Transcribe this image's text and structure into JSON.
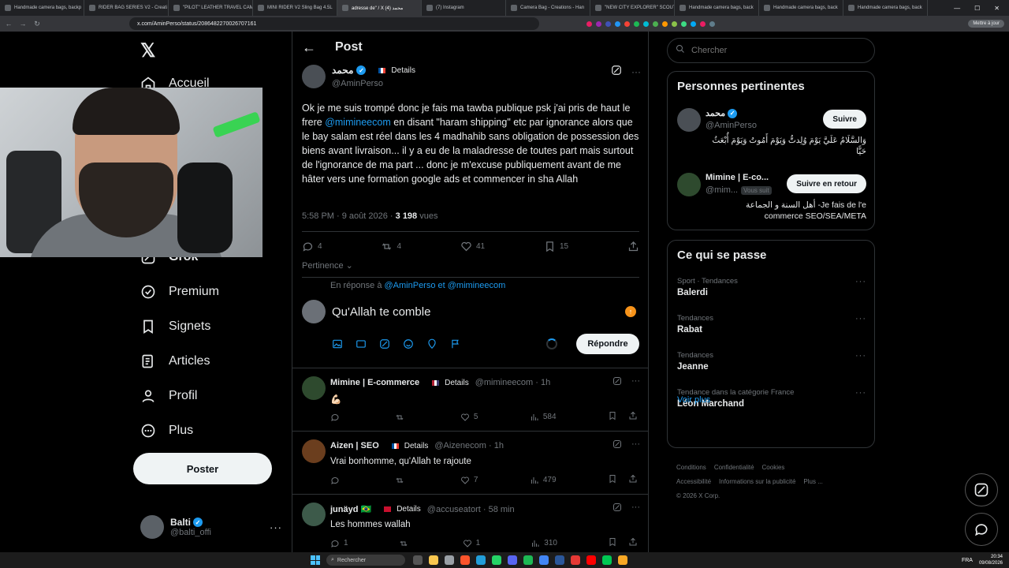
{
  "browser": {
    "tabs": [
      {
        "label": "Handmade camera bags, backp"
      },
      {
        "label": "RIDER BAG SERIES V2 - Creati"
      },
      {
        "label": "\"PILOT\" LEATHER TRAVEL CAM"
      },
      {
        "label": "MINI RIDER V2 Sling Bag 4.5L"
      },
      {
        "label": "adresse de\" / X محمد (4)"
      },
      {
        "label": "(7) Instagram"
      },
      {
        "label": "Camera Bag - Creations - Han"
      },
      {
        "label": "\"NEW CITY EXPLORER\" SCOUT"
      },
      {
        "label": "Handmade camera bags, back"
      },
      {
        "label": "Handmade camera bags, back"
      },
      {
        "label": "Handmade camera bags, back"
      }
    ],
    "url": "x.com/AminPerso/status/2086482270026707161",
    "menu_pill": "Mettre à jour",
    "ext_colors": [
      "#e91e63",
      "#9c27b0",
      "#3f51b5",
      "#2196f3",
      "#f44336",
      "#1db954",
      "#00bcd4",
      "#4caf50",
      "#ff9800",
      "#8bc34a",
      "#3ddc84",
      "#03a9f4",
      "#e91e63",
      "#607d8b"
    ]
  },
  "nav": {
    "home": "Accueil",
    "grok": "Grok",
    "premium": "Premium",
    "bookmarks": "Signets",
    "articles": "Articles",
    "profile": "Profil",
    "more": "Plus",
    "post_button": "Poster",
    "account_name": "Balti",
    "account_handle": "@balti_offi"
  },
  "main": {
    "title": "Post",
    "tweet": {
      "author": "محمد",
      "details": "Details",
      "handle": "@AminPerso",
      "text_a": "Ok je me suis trompé donc je fais ma tawba publique psk j'ai pris de haut le frere ",
      "mention": "@mimineecom",
      "text_b": " en disant \"haram shipping\" etc par ignorance alors que le bay salam est réel dans les 4 madhahib sans obligation de possession des biens avant livraison... il y a eu de la maladresse de toutes part mais surtout de l'ignorance de ma part ... donc je m'excuse publiquement avant de me hâter vers une formation google ads et commencer in sha Allah",
      "time": "5:58 PM · 9 août 2026 · ",
      "views_count": "3 198",
      "views_label": " vues",
      "replies": "4",
      "reposts": "4",
      "likes": "41",
      "bookmarks": "15"
    },
    "sort_label": "Pertinence",
    "reply_to_prefix": "En réponse à ",
    "reply_to_users": "@AminPerso et @mimineecom",
    "composer_value": "Qu'Allah te comble",
    "reply_button": "Répondre",
    "replies": [
      {
        "name": "Mimine | E-commerce",
        "details": "Details",
        "meta": "@mimineecom · 1h",
        "text": "💪🏻",
        "likes": "5",
        "views": "584",
        "replies": "",
        "reposts": ""
      },
      {
        "name": "Aizen | SEO",
        "details": "Details",
        "meta": "@Aizenecom · 1h",
        "text": "Vrai bonhomme, qu'Allah te rajoute",
        "likes": "7",
        "views": "479",
        "replies": "",
        "reposts": ""
      },
      {
        "name": "junäyd 🇧🇷",
        "details": "Details",
        "meta": "@accuseatort · 58 min",
        "text": "Les hommes wallah",
        "likes": "1",
        "views": "310",
        "replies": "1",
        "reposts": ""
      }
    ]
  },
  "right": {
    "search_placeholder": "Chercher",
    "people_title": "Personnes pertinentes",
    "people": [
      {
        "name": "محمد",
        "handle": "@AminPerso",
        "follows_you": "",
        "button": "Suivre",
        "bio": "وَالسَّلَامُ عَلَيَّ يَوْمَ وُلِدتُّ وَيَوْمَ أَمُوتُ وَيَوْمَ أُبْعَثُ حَيًّا"
      },
      {
        "name": "Mimine | E-co...",
        "handle": "@mim...",
        "follows_you": "Vous suit",
        "button": "Suivre en retour",
        "bio": "أهل السنة و الجماعة -Je fais de l'e commerce SEO/SEA/META"
      }
    ],
    "trends_title": "Ce qui se passe",
    "trends": [
      {
        "category": "Sport · Tendances",
        "name": "Balerdi"
      },
      {
        "category": "Tendances",
        "name": "Rabat"
      },
      {
        "category": "Tendances",
        "name": "Jeanne"
      },
      {
        "category": "Tendance dans la catégorie France",
        "name": "Léon Marchand"
      }
    ],
    "see_more": "Voir plus",
    "footer": [
      "Conditions",
      "Confidentialité",
      "Cookies",
      "Accessibilité",
      "Informations sur la publicité",
      "Plus ...",
      "© 2026 X Corp."
    ]
  },
  "taskbar": {
    "search": "Rechercher",
    "lang": "FRA",
    "time": "20:34",
    "date": "09/08/2026"
  }
}
